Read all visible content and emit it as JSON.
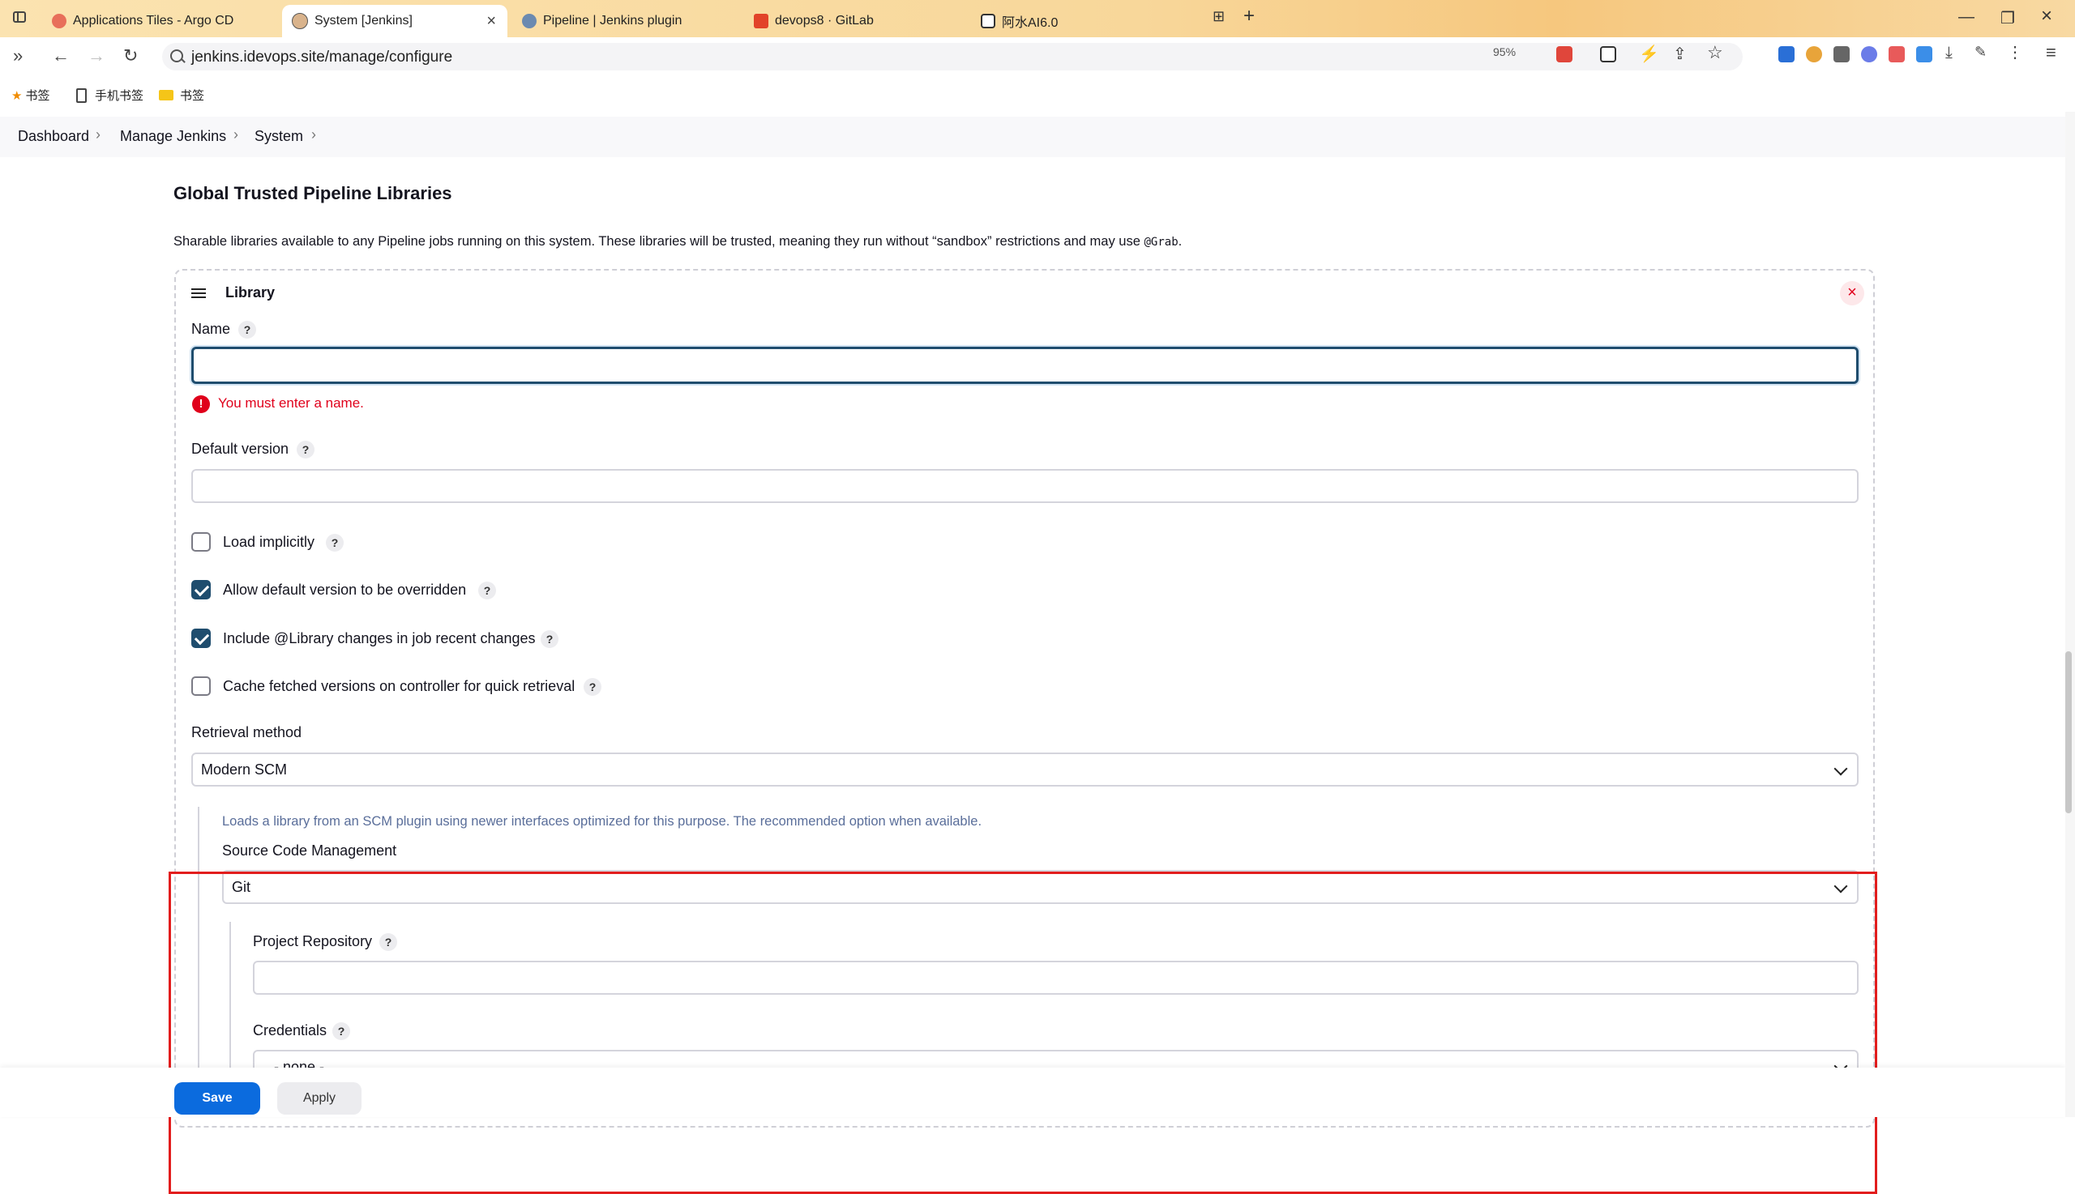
{
  "browser": {
    "tabs": [
      {
        "title": "Applications Tiles - Argo CD",
        "active": false
      },
      {
        "title": "System [Jenkins]",
        "active": true
      },
      {
        "title": "Pipeline | Jenkins plugin",
        "active": false
      },
      {
        "title": "devops8 · GitLab",
        "active": false
      },
      {
        "title": "阿水AI6.0",
        "active": false
      }
    ],
    "url": "jenkins.idevops.site/manage/configure",
    "zoom": "95%",
    "bookmarks": [
      "书签",
      "手机书签",
      "书签"
    ]
  },
  "breadcrumb": [
    "Dashboard",
    "Manage Jenkins",
    "System"
  ],
  "section": {
    "title": "Global Trusted Pipeline Libraries",
    "description": "Sharable libraries available to any Pipeline jobs running on this system. These libraries will be trusted, meaning they run without “sandbox” restrictions and may use ",
    "description_code": "@Grab",
    "description_end": "."
  },
  "library": {
    "title": "Library",
    "delete": "×",
    "help": "?",
    "name_label": "Name",
    "name_value": "",
    "name_error": "You must enter a name.",
    "error_icon": "!",
    "default_version_label": "Default version",
    "default_version_value": "",
    "checkboxes": [
      {
        "label": "Load implicitly",
        "checked": false
      },
      {
        "label": "Allow default version to be overridden",
        "checked": true
      },
      {
        "label": "Include @Library changes in job recent changes",
        "checked": true
      },
      {
        "label": "Cache fetched versions on controller for quick retrieval",
        "checked": false
      }
    ],
    "retrieval_method_label": "Retrieval method",
    "retrieval_method_value": "Modern SCM",
    "retrieval_description": "Loads a library from an SCM plugin using newer interfaces optimized for this purpose. The recommended option when available.",
    "scm_label": "Source Code Management",
    "scm_value": "Git",
    "project_repository_label": "Project Repository",
    "project_repository_value": "",
    "credentials_label": "Credentials",
    "credentials_value": "- none -"
  },
  "actions": {
    "save": "Save",
    "apply": "Apply"
  },
  "colors": {
    "primary": "#0b6bde",
    "error": "#e0001b",
    "highlight": "#e21d1d",
    "checkbox": "#1f4d6e"
  }
}
